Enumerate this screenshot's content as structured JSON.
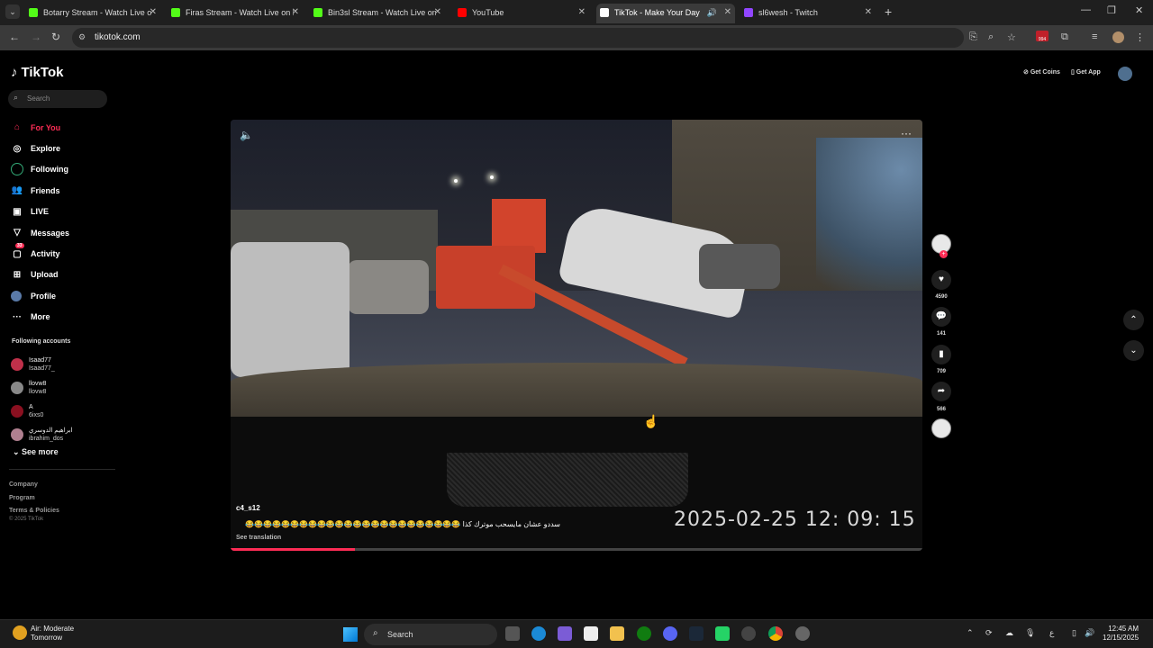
{
  "browser": {
    "tabs": [
      {
        "title": "Botarry Stream - Watch Live on",
        "color": "#53fc18"
      },
      {
        "title": "Firas Stream - Watch Live on Ki",
        "color": "#53fc18"
      },
      {
        "title": "Bin3sl Stream - Watch Live on K",
        "color": "#53fc18"
      },
      {
        "title": "YouTube",
        "color": "#ff0000"
      },
      {
        "title": "TikTok - Make Your Day",
        "color": "#ffffff"
      },
      {
        "title": "sl6wesh - Twitch",
        "color": "#9146ff"
      }
    ],
    "url": "tikotok.com",
    "extension_badge": "994"
  },
  "tiktok": {
    "logo": "TikTok",
    "search_placeholder": "Search",
    "nav": [
      {
        "label": "For You",
        "icon": "home-icon"
      },
      {
        "label": "Explore",
        "icon": "compass-icon"
      },
      {
        "label": "Following",
        "icon": "following-icon"
      },
      {
        "label": "Friends",
        "icon": "friends-icon"
      },
      {
        "label": "LIVE",
        "icon": "live-icon"
      },
      {
        "label": "Messages",
        "icon": "messages-icon"
      },
      {
        "label": "Activity",
        "icon": "activity-icon",
        "badge": "33"
      },
      {
        "label": "Upload",
        "icon": "upload-icon"
      },
      {
        "label": "Profile",
        "icon": "profile-icon"
      },
      {
        "label": "More",
        "icon": "more-icon"
      }
    ],
    "following_title": "Following accounts",
    "following": [
      {
        "name": "Isaad77",
        "user": "Isaad77_",
        "color": "#c0304a"
      },
      {
        "name": "llovw8",
        "user": "llovw8",
        "color": "#888888"
      },
      {
        "name": "A",
        "user": "6ixs0",
        "color": "#8a1020"
      },
      {
        "name": "ابراهيم الدوسري",
        "user": "ibrahim_dos",
        "color": "#b08090"
      }
    ],
    "see_more": "See more",
    "footer": {
      "company": "Company",
      "program": "Program",
      "terms": "Terms & Policies",
      "copyright": "© 2025 TikTok"
    },
    "get_coins": "Get Coins",
    "get_app": "Get App",
    "video": {
      "timestamp": "2025-02-25   12: 09: 15",
      "author": "c4_s12",
      "caption": "سددو عشان مايسحب موترك كذا 😂😂😂😂😂😂😂😂😂😂😂😂😂😂😂😂😂😂😂😂😂😂😂😂",
      "see_translation": "See translation",
      "progress": 0.18
    },
    "actions": {
      "likes": "4590",
      "comments": "141",
      "saves": "709",
      "shares": "566"
    }
  },
  "taskbar": {
    "weather_title": "Air: Moderate",
    "weather_sub": "Tomorrow",
    "search": "Search",
    "time": "12:45 AM",
    "date": "12/15/2025",
    "lang": "ع"
  }
}
